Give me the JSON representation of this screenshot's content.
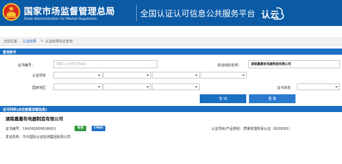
{
  "header": {
    "title_cn": "国家市场监督管理总局",
    "title_en": "State Administration for Market Regulation",
    "platform_title": "全国认证认可信息公共服务平台",
    "platform_logo_text": "认云"
  },
  "breadcrumb": {
    "label": "当前位置：",
    "item_1": "认证结果",
    "sep": ">",
    "item_2": "认证结果综合查询"
  },
  "query_section": {
    "title": "查询条件",
    "cert_number_label": "证书编号：",
    "cert_number_placeholder": "请输入证书的证书编号",
    "org_name_label": "获证组织名称：",
    "org_name_value": "湖南嘉嘉有电器制造有限公司",
    "cert_item_label": "认证项目",
    "region_label": "国家地区",
    "cert_status_label": "证书状态",
    "search_button": "查 询",
    "reset_button": "重 置"
  },
  "result_list": {
    "title": "证书列表(点击查看详细信息)",
    "items": [
      {
        "company": "湖南嘉嘉有电器制造有限公司",
        "cert_no_label": "证书编号：",
        "cert_no": "16426Q00062R001",
        "status_badge": "有效",
        "accreditation_badge": "CNAS",
        "cert_item_label": "认证项目/产品类别：",
        "cert_item": "质量管理体系认证（ISO9001）",
        "issuer_label": "发证机构：",
        "issuer": "华中国际认证检测集团有限公司"
      }
    ]
  },
  "colors": {
    "header_bg": "#0a5aa6",
    "bar_bg": "#1a6fc2",
    "valid_badge": "#2e9a3b",
    "cnas_badge": "#1e72c8",
    "emblem_red": "#d9261c",
    "emblem_gold": "#f2c230"
  },
  "icons": {
    "emblem": "national-emblem-icon",
    "platform_logo": "renyun-logo-icon"
  }
}
